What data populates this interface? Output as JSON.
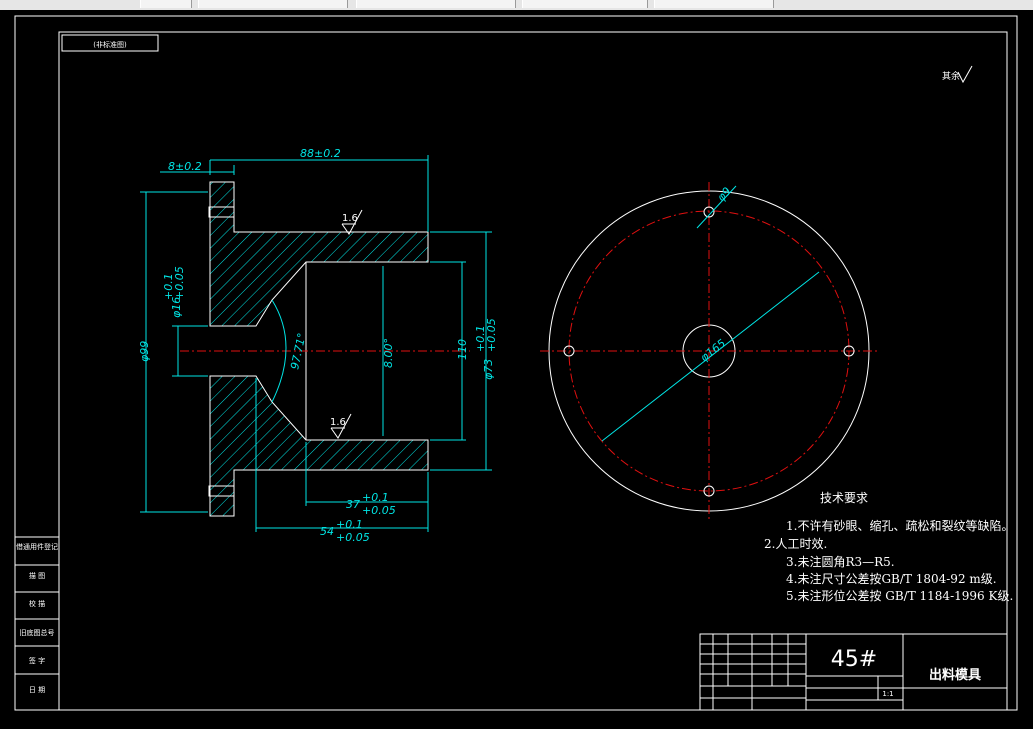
{
  "taskbar": {
    "tabs": [
      "",
      "",
      "",
      "",
      ""
    ]
  },
  "frame": {
    "top_left_label": "(非标准图)",
    "roughness_note": "其余"
  },
  "section_view": {
    "dim_flange_thk": "8±0.2",
    "dim_length": "88±0.2",
    "dim_outer": "φ99",
    "dim_bore": "φ16",
    "dim_bore_tol_up": "+0.1",
    "dim_bore_tol_low": "+0.05",
    "dim_cone_angle": "97.71°",
    "dim_inner": "8.00°",
    "dim_110": "110",
    "dim_73": "φ73",
    "dim_73_tol_up": "+0.1",
    "dim_73_tol_low": "+0.05",
    "dim_37": "37",
    "dim_37_tol_up": "+0.1",
    "dim_37_tol_low": "+0.05",
    "dim_54": "54",
    "dim_54_tol_up": "+0.1",
    "dim_54_tol_low": "+0.05",
    "roughness_top": "1.6",
    "roughness_bottom": "1.6"
  },
  "plan_view": {
    "dim_hole": "φ9",
    "dim_center": "φ165"
  },
  "tech_requirements": {
    "title": "技术要求",
    "items": [
      "1.不许有砂眼、缩孔、疏松和裂纹等缺陷。",
      "2.人工时效.",
      "3.未注圆角R3—R5.",
      "4.未注尺寸公差按GB/T 1804-92 m级.",
      "5.未注形位公差按 GB/T 1184-1996 K级."
    ]
  },
  "left_strip": {
    "cells": [
      "借通用件登记",
      "旧底图总号",
      "描 图",
      "校 描",
      "签 字",
      "日 期"
    ]
  },
  "title_block": {
    "material": "45#",
    "part_name": "出料模具",
    "scale": "1:1"
  }
}
